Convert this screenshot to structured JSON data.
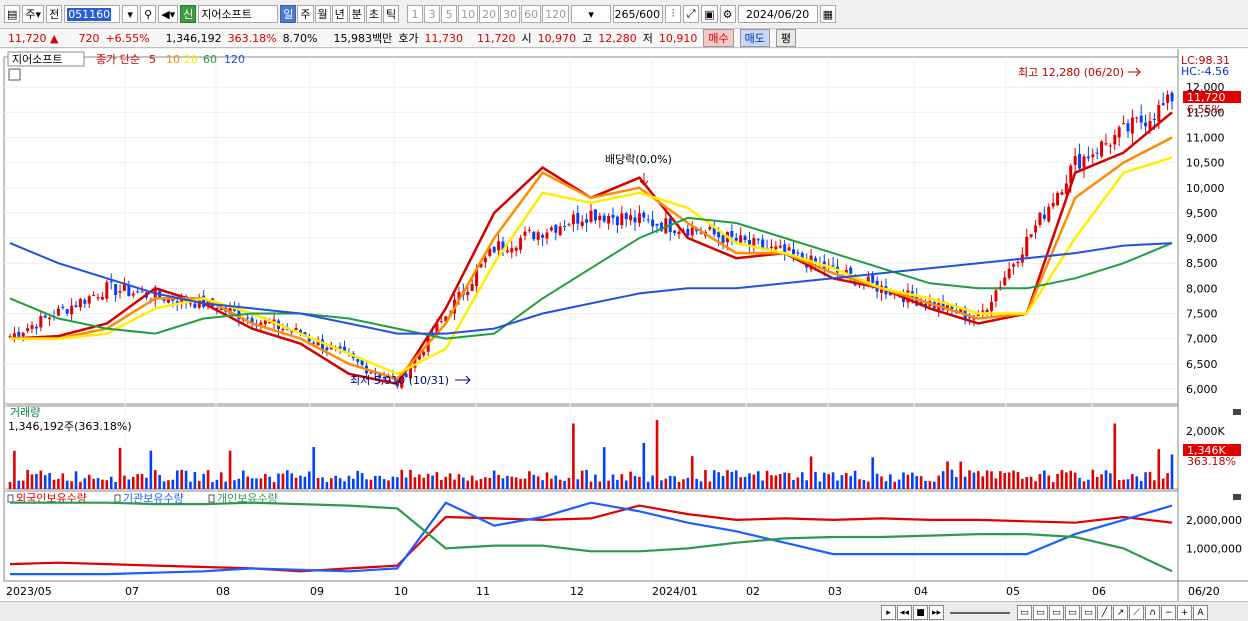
{
  "toolbar": {
    "type1": "주",
    "type2": "전",
    "code": "051160",
    "badge": "신",
    "name": "지어소프트",
    "periods": [
      {
        "label": "일",
        "active": true
      },
      {
        "label": "주",
        "active": false
      },
      {
        "label": "월",
        "active": false
      },
      {
        "label": "년",
        "active": false
      },
      {
        "label": "분",
        "active": false
      },
      {
        "label": "초",
        "active": false
      },
      {
        "label": "틱",
        "active": false
      }
    ],
    "intervals": [
      "1",
      "3",
      "5",
      "10",
      "20",
      "30",
      "60",
      "120"
    ],
    "count": "265",
    "total": "/600",
    "date": "2024/06/20"
  },
  "quote": {
    "price": "11,720 ▲",
    "change": "720",
    "change_pct": "+6.55%",
    "volume": "1,346,192",
    "volume_ratio": "363.18%",
    "turnover": "8.70%",
    "amount": "15,983백만",
    "ask_label": "호가",
    "ask": "11,730",
    "bid": "11,720",
    "open_label": "시",
    "open": "10,970",
    "high_label": "고",
    "high": "12,280",
    "low_label": "저",
    "low": "10,910",
    "buy": "매수",
    "sell": "매도",
    "avg": "평"
  },
  "colors": {
    "up": "#e00000",
    "down": "#0040ff",
    "ma5": "#d40000",
    "ma10": "#ff8c00",
    "ma20": "#ffee00",
    "ma60": "#1e9e3e",
    "ma120": "#2450e0",
    "frgn": "#e00000",
    "inst": "#1a5fff",
    "indiv": "#2c9a4e"
  },
  "price_panel": {
    "legend_name": "지어소프트",
    "legend_ma_label": "종가 단순",
    "ma_labels": [
      "5",
      "10",
      "20",
      "60",
      "120"
    ],
    "lc": "LC:98.31",
    "hc": "HC:-4.56",
    "current_tag": "11,720",
    "current_pct": "6.55%",
    "high_ann": "최고 12,280 (06/20)",
    "low_ann": "최저 5,910 (10/31)",
    "dividend_ann": "배당락(0,0%)"
  },
  "volume_panel": {
    "title": "거래량",
    "value": "1,346,192주(363.18%)",
    "current_tag": "1,346K",
    "current_pct": "363.18%"
  },
  "holding_panel": {
    "labels": [
      "외국인보유수량",
      "기관보유수량",
      "개인보유수량"
    ]
  },
  "time_axis": [
    "2023/05",
    "07",
    "08",
    "09",
    "10",
    "11",
    "12",
    "2024/01",
    "02",
    "03",
    "04",
    "05",
    "06",
    "06/20"
  ],
  "chart_data": {
    "type": "candlestick",
    "title": "지어소프트",
    "price_axis": {
      "ticks": [
        6000,
        6500,
        7000,
        7500,
        8000,
        8500,
        9000,
        9500,
        10000,
        10500,
        11000,
        11500,
        12000
      ],
      "range": [
        5700,
        12600
      ]
    },
    "ohlc_monthly_approx": [
      {
        "x": "2023/05",
        "o": 7000,
        "h": 7400,
        "l": 6800,
        "c": 7050
      },
      {
        "x": "07",
        "o": 7050,
        "h": 8500,
        "l": 6900,
        "c": 8000
      },
      {
        "x": "08",
        "o": 8000,
        "h": 8450,
        "l": 7500,
        "c": 7700
      },
      {
        "x": "09",
        "o": 7700,
        "h": 8000,
        "l": 6900,
        "c": 7100
      },
      {
        "x": "10",
        "o": 7100,
        "h": 7200,
        "l": 5910,
        "c": 6100
      },
      {
        "x": "11",
        "o": 6100,
        "h": 9000,
        "l": 6000,
        "c": 8800
      },
      {
        "x": "12",
        "o": 8800,
        "h": 10900,
        "l": 8700,
        "c": 9500
      },
      {
        "x": "2024/01",
        "o": 9500,
        "h": 10900,
        "l": 8800,
        "c": 9200
      },
      {
        "x": "02",
        "o": 9200,
        "h": 9300,
        "l": 8400,
        "c": 8700
      },
      {
        "x": "03",
        "o": 8700,
        "h": 8800,
        "l": 7700,
        "c": 8000
      },
      {
        "x": "04",
        "o": 8000,
        "h": 8100,
        "l": 7100,
        "c": 7400
      },
      {
        "x": "05",
        "o": 7400,
        "h": 11300,
        "l": 7300,
        "c": 10500
      },
      {
        "x": "06",
        "o": 10500,
        "h": 12280,
        "l": 10100,
        "c": 11720
      }
    ],
    "series": [
      {
        "name": "5",
        "values": [
          7000,
          7050,
          7300,
          8000,
          7700,
          7200,
          6900,
          6300,
          6100,
          7600,
          9500,
          10400,
          9800,
          10200,
          9000,
          8600,
          8700,
          8200,
          8000,
          7600,
          7300,
          7500,
          10300,
          10700,
          11500
        ]
      },
      {
        "name": "10",
        "values": [
          7000,
          7000,
          7200,
          7800,
          7800,
          7300,
          7000,
          6500,
          6200,
          7300,
          9000,
          10300,
          9800,
          10000,
          9300,
          8700,
          8700,
          8300,
          8000,
          7700,
          7400,
          7500,
          9800,
          10500,
          11000
        ]
      },
      {
        "name": "20",
        "values": [
          7000,
          7000,
          7100,
          7600,
          7800,
          7500,
          7100,
          6700,
          6300,
          6800,
          8500,
          9900,
          9700,
          9900,
          9600,
          8900,
          8700,
          8400,
          8000,
          7800,
          7500,
          7500,
          9000,
          10300,
          10600
        ]
      },
      {
        "name": "60",
        "values": [
          7800,
          7400,
          7200,
          7100,
          7400,
          7500,
          7500,
          7400,
          7200,
          7000,
          7100,
          7800,
          8400,
          9000,
          9400,
          9300,
          9000,
          8700,
          8400,
          8100,
          8000,
          8000,
          8200,
          8500,
          8900
        ]
      },
      {
        "name": "120",
        "values": [
          8900,
          8500,
          8200,
          7900,
          7700,
          7600,
          7500,
          7300,
          7100,
          7100,
          7200,
          7500,
          7700,
          7900,
          8000,
          8000,
          8100,
          8200,
          8300,
          8400,
          8500,
          8600,
          8700,
          8850,
          8900
        ]
      }
    ],
    "volume_axis": {
      "ticks": [
        "2,000K"
      ]
    },
    "holding_axis": {
      "ticks": [
        "2,000,000",
        "1,000,000"
      ]
    },
    "holding_series": [
      {
        "name": "외국인보유수량",
        "values": [
          0.45,
          0.5,
          0.45,
          0.4,
          0.35,
          0.3,
          0.2,
          0.3,
          0.4,
          2.1,
          2.05,
          2.0,
          2.05,
          2.5,
          2.2,
          2.0,
          2.05,
          2.0,
          2.05,
          2.0,
          2.0,
          1.95,
          1.9,
          2.1,
          1.9
        ]
      },
      {
        "name": "기관보유수량",
        "values": [
          0.1,
          0.1,
          0.1,
          0.15,
          0.2,
          0.3,
          0.25,
          0.2,
          0.3,
          2.6,
          1.8,
          2.1,
          2.6,
          2.3,
          1.9,
          1.6,
          1.2,
          0.8,
          0.8,
          0.8,
          0.8,
          0.8,
          1.5,
          2.0,
          2.5
        ]
      },
      {
        "name": "개인보유수량",
        "values": [
          2.6,
          2.6,
          2.6,
          2.55,
          2.55,
          2.6,
          2.55,
          2.5,
          2.4,
          1.0,
          1.1,
          1.1,
          0.9,
          0.9,
          1.0,
          1.2,
          1.35,
          1.4,
          1.4,
          1.45,
          1.5,
          1.5,
          1.4,
          1.0,
          0.2
        ]
      }
    ]
  }
}
